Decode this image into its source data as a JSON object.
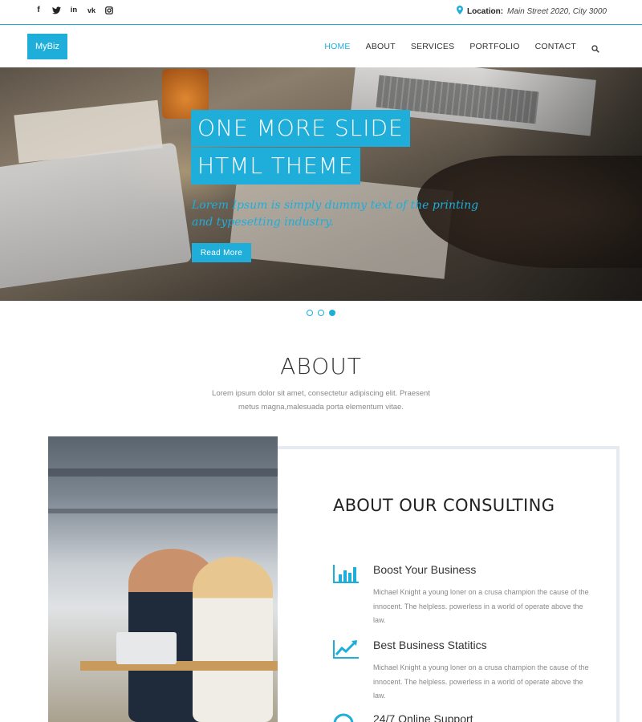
{
  "topbar": {
    "social_icons": [
      "facebook-icon",
      "twitter-icon",
      "linkedin-icon",
      "vk-icon",
      "instagram-icon"
    ],
    "location_label": "Location:",
    "location_value": "Main Street 2020, City 3000"
  },
  "header": {
    "logo": "MyBiz",
    "nav": [
      "HOME",
      "ABOUT",
      "SERVICES",
      "PORTFOLIO",
      "CONTACT"
    ],
    "active_nav": "HOME"
  },
  "hero": {
    "title_line1": "ONE MORE SLIDE",
    "title_line2": "HTML THEME",
    "subtitle": "Lorem Ipsum is simply dummy text of the printing and typesetting industry.",
    "button": "Read More",
    "slides": 3,
    "active_slide": 3
  },
  "about": {
    "title": "ABOUT",
    "text": "Lorem ipsum dolor sit amet, consectetur adipiscing elit. Praesent metus magna,malesuada porta elementum vitae.",
    "card_title": "ABOUT OUR CONSULTING",
    "features": [
      {
        "icon": "bar-chart-icon",
        "title": "Boost Your Business",
        "desc": "Michael Knight a young loner on a crusa champion the cause of the innocent. The helpless. powerless in a world of operate above the law."
      },
      {
        "icon": "trend-up-icon",
        "title": "Best Business Statitics",
        "desc": "Michael Knight a young loner on a crusa champion the cause of the innocent. The helpless. powerless in a world of operate above the law."
      },
      {
        "icon": "support-icon",
        "title": "24/7 Online Support",
        "desc": ""
      }
    ]
  },
  "colors": {
    "accent": "#1eaed9"
  }
}
